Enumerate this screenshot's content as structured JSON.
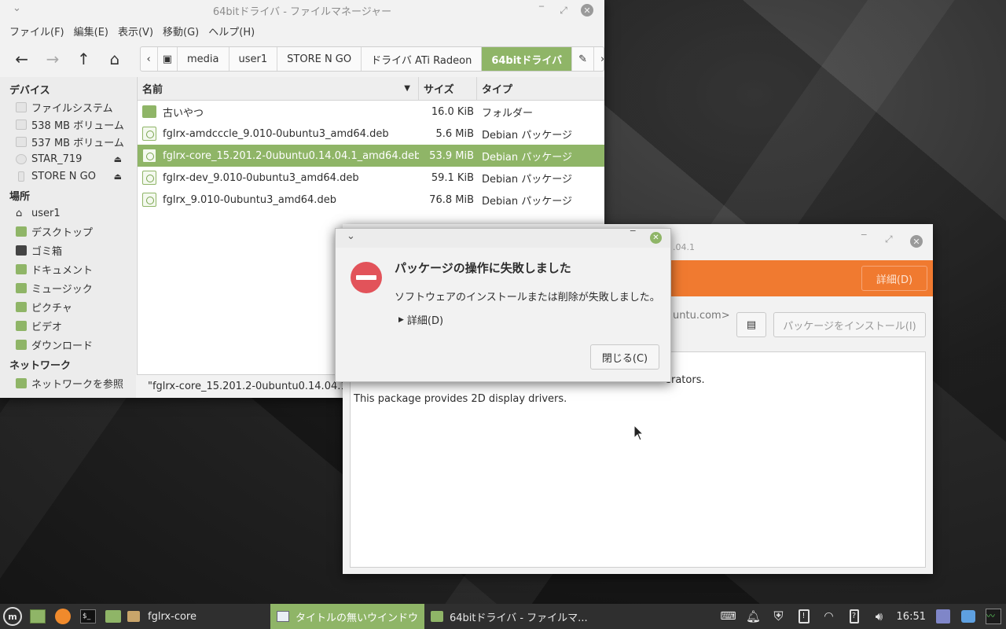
{
  "file_manager": {
    "title": "64bitドライバ - ファイルマネージャー",
    "menu": [
      "ファイル(F)",
      "編集(E)",
      "表示(V)",
      "移動(G)",
      "ヘルプ(H)"
    ],
    "breadcrumb": [
      "media",
      "user1",
      "STORE N GO",
      "ドライバ ATi Radeon",
      "64bitドライバ"
    ],
    "sidebar": {
      "devices_header": "デバイス",
      "devices": [
        "ファイルシステム",
        "538 MB ボリューム",
        "537 MB ボリューム",
        "STAR_719",
        "STORE N GO"
      ],
      "places_header": "場所",
      "places": [
        "user1",
        "デスクトップ",
        "ゴミ箱",
        "ドキュメント",
        "ミュージック",
        "ピクチャ",
        "ビデオ",
        "ダウンロード"
      ],
      "network_header": "ネットワーク",
      "network": [
        "ネットワークを参照"
      ]
    },
    "columns": [
      "名前",
      "サイズ",
      "タイプ"
    ],
    "files": [
      {
        "name": "古いやつ",
        "size": "16.0 KiB",
        "type": "フォルダー"
      },
      {
        "name": "fglrx-amdcccle_9.010-0ubuntu3_amd64.deb",
        "size": "5.6 MiB",
        "type": "Debian パッケージ"
      },
      {
        "name": "fglrx-core_15.201.2-0ubuntu0.14.04.1_amd64.deb",
        "size": "53.9 MiB",
        "type": "Debian パッケージ"
      },
      {
        "name": "fglrx-dev_9.010-0ubuntu3_amd64.deb",
        "size": "59.1 KiB",
        "type": "Debian パッケージ"
      },
      {
        "name": "fglrx_9.010-0ubuntu3_amd64.deb",
        "size": "76.8 MiB",
        "type": "Debian パッケージ"
      }
    ],
    "status": "\"fglrx-core_15.201.2-0ubuntu0.14.04.1_"
  },
  "installer": {
    "title_partial": ".04.1",
    "details_button": "詳細(D)",
    "maintainer_partial": "untu.com>",
    "install_button": "パッケージをインストール(I)",
    "desc_line1_partial": "erators.",
    "desc_line2": "This package provides 2D display drivers."
  },
  "dialog": {
    "heading": "パッケージの操作に失敗しました",
    "message": "ソフトウェアのインストールまたは削除が失敗しました。",
    "details": "詳細(D)",
    "close_button": "閉じる(C)"
  },
  "taskbar": {
    "tasks": [
      "fglrx-core",
      "タイトルの無いウインドウ",
      "64bitドライバ - ファイルマ..."
    ],
    "clock": "16:51"
  },
  "colors": {
    "accent": "#8fb567",
    "orange": "#f07a30",
    "error": "#e2535a",
    "taskbar": "#2f2f2f"
  }
}
